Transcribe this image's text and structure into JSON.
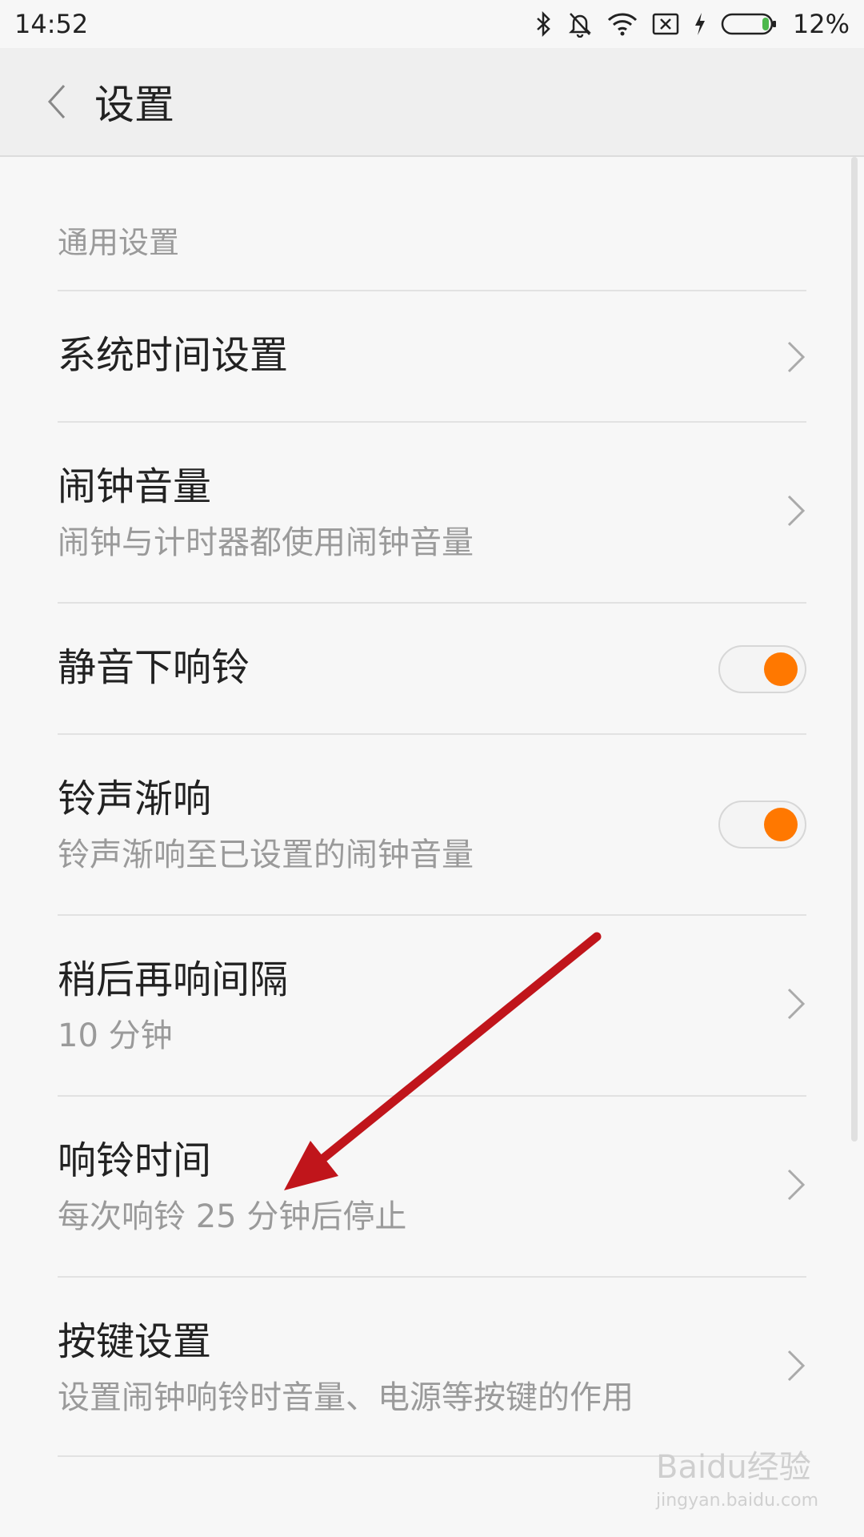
{
  "status_bar": {
    "time": "14:52",
    "battery_percent": "12%",
    "battery_level": 0.12,
    "battery_color": "#4cb84c"
  },
  "header": {
    "title": "设置"
  },
  "section": {
    "label": "通用设置"
  },
  "rows": [
    {
      "title": "系统时间设置",
      "subtitle": "",
      "control": "chevron"
    },
    {
      "title": "闹钟音量",
      "subtitle": "闹钟与计时器都使用闹钟音量",
      "control": "chevron"
    },
    {
      "title": "静音下响铃",
      "subtitle": "",
      "control": "toggle",
      "on": true
    },
    {
      "title": "铃声渐响",
      "subtitle": "铃声渐响至已设置的闹钟音量",
      "control": "toggle",
      "on": true
    },
    {
      "title": "稍后再响间隔",
      "subtitle": "10 分钟",
      "control": "chevron"
    },
    {
      "title": "响铃时间",
      "subtitle": "每次响铃 25 分钟后停止",
      "control": "chevron"
    },
    {
      "title": "按键设置",
      "subtitle": "设置闹钟响铃时音量、电源等按键的作用",
      "control": "chevron"
    }
  ],
  "colors": {
    "accent": "#ff7800",
    "annotation_arrow": "#c0151b"
  },
  "watermark": {
    "brand": "Baidu经验",
    "url": "jingyan.baidu.com"
  }
}
